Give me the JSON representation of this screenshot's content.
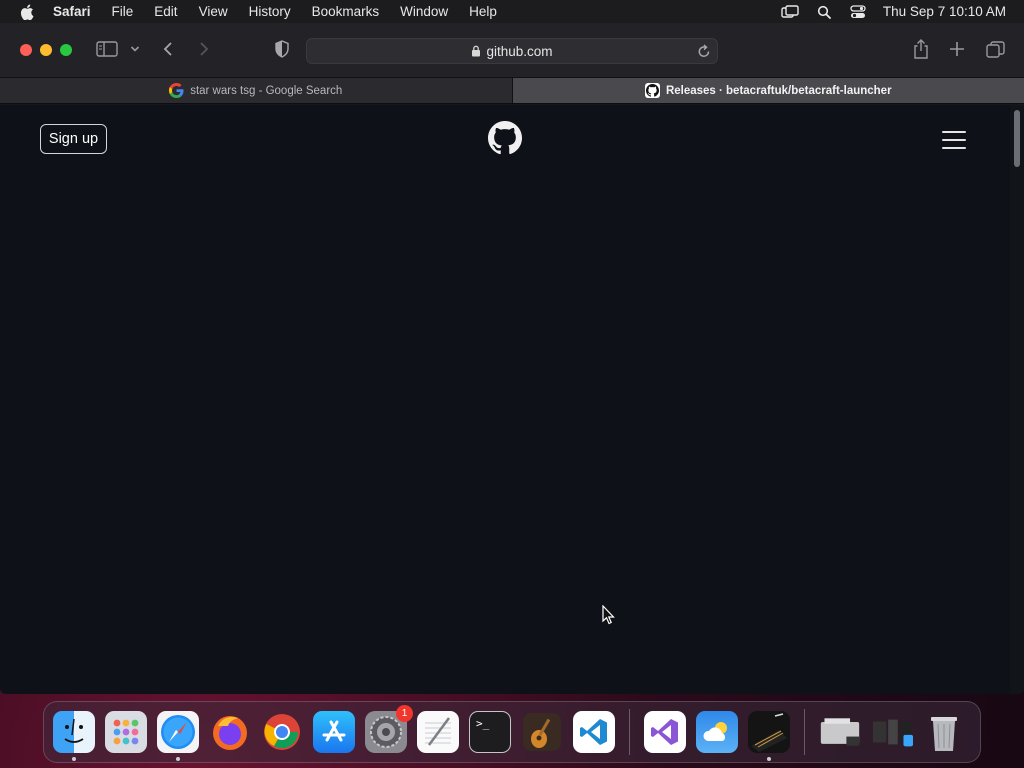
{
  "menubar": {
    "app_name": "Safari",
    "items": [
      "File",
      "Edit",
      "View",
      "History",
      "Bookmarks",
      "Window",
      "Help"
    ],
    "clock": "Thu Sep 7  10:10 AM",
    "status_icons": [
      "screen-mirroring-icon",
      "spotlight-search-icon",
      "control-center-icon"
    ]
  },
  "toolbar": {
    "address": "github.com"
  },
  "tabs": [
    {
      "label": "star wars tsg - Google Search",
      "favicon": "google-icon",
      "active": false
    },
    {
      "label": "Releases · betacraftuk/betacraft-launcher",
      "favicon": "github-icon",
      "active": true
    }
  ],
  "page": {
    "signup_label": "Sign up"
  },
  "dock": {
    "badge_count": "1",
    "apps": [
      "Finder",
      "Launchpad",
      "Safari",
      "Firefox",
      "Chrome",
      "App Store",
      "System Preferences",
      "TextEdit",
      "Terminal",
      "GarageBand",
      "Visual Studio Code",
      "Visual Studio",
      "Weather",
      "Piano",
      "Downloads",
      "Applications",
      "Trash"
    ]
  },
  "colors": {
    "page_bg": "#0e1117",
    "toolbar_bg": "#232226",
    "accent_close": "#fe5f57",
    "accent_min": "#febc2e",
    "accent_max": "#28c840"
  }
}
